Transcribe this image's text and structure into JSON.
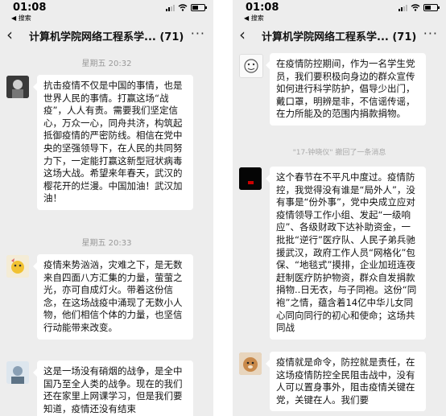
{
  "left": {
    "status": {
      "time": "01:08",
      "back_app": "◀ 搜索"
    },
    "nav": {
      "title": "计算机学院网络工程系学...",
      "count": "(71)"
    },
    "messages": [
      {
        "time_label": "星期五 20:32",
        "text": "抗击疫情不仅是中国的事情，也是世界人民的事情。打赢这场“战疫”，人人有责。需要我们坚定信心，万众一心，同舟共济，构筑起抵御疫情的严密防线。相信在党中央的坚强领导下，在人民的共同努力下，一定能打赢这新型冠状病毒这场大战。希望来年春天，武汉的樱花开的烂漫。中国加油！武汉加油！"
      },
      {
        "time_label": "星期五 20:33",
        "text": "疫情来势汹汹，灾难之下，是无数来自四面八方汇集的力量，萤萤之光，亦可自成灯火。带着这份信念，在这场战疫中涌现了无数小人物，他们相信个体的力量，也坚信行动能带来改变。"
      },
      {
        "text": "这是一场没有硝烟的战争，是全中国乃至全人类的战争。现在的我们还在家里上网课学习，但是我们要知道，疫情还没有结束"
      }
    ]
  },
  "right": {
    "status": {
      "time": "01:08",
      "back_app": "◀ 搜索"
    },
    "nav": {
      "title": "计算机学院网络工程系学...",
      "count": "(71)"
    },
    "messages": [
      {
        "text": "在疫情防控期间，作为一名学生党员，我们要积极向身边的群众宣传如何进行科学防护，倡导少出门，戴口罩，明辨是非，不信谣传谣，在力所能及的范围内捐款捐物。"
      },
      {
        "text": "这个春节在不平凡中度过。疫情防控，我觉得没有谁是“局外人”，没有事是“份外事”，党中央成立应对疫情领导工作小组、发起“一级响应”、各级财政下达补助资金，一批批“逆行”医疗队、人民子弟兵驰援武汉，政府工作人员“网格化”包保、“地毯式”摸排，企业加班连夜赶制医疗防护物资，群众自发捐款捐物..日无衣，与子同袍。这份“同袍”之情，蕴含着14亿中华儿女同心同向同行的初心和使命；这场共同战"
      },
      {
        "text": "疫情就是命令，防控就是责任，在这场疫情防控全民阻击战中，没有人可以置身事外，阻击疫情关键在党，关键在人。我们要"
      }
    ],
    "recall_notice": "\"17-钟晓仪\" 撤回了一条消息"
  }
}
